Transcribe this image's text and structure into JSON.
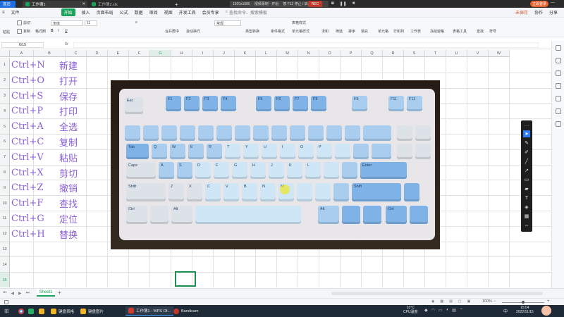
{
  "titlebar": {
    "home_tab": "首页",
    "doc_tab": "工作簿1",
    "doc_tab2": "工作簿2.xls",
    "add_tab": "+",
    "recorder": {
      "resolution": "1920x1080",
      "status": "视频录制 - 开始",
      "shortcut": "按 F12 停止 / 启动",
      "rec": "REC"
    },
    "user": "立即登录"
  },
  "menubar": {
    "file": "文件",
    "start": "开始",
    "items": [
      "插入",
      "页面布局",
      "公式",
      "数据",
      "审阅",
      "视图",
      "开发工具",
      "会员专享"
    ],
    "search": "查找命令、搜索模板",
    "right": [
      "未保存",
      "协作",
      "分享"
    ]
  },
  "ribbon": {
    "paste": "粘贴",
    "cut": "剪切",
    "copy": "复制",
    "format_painter": "格式刷",
    "font": "宋体",
    "font_size": "11",
    "merge": "合并居中",
    "wrap": "自动换行",
    "number_format": "常规",
    "type_convert": "类型转换",
    "cond_format": "条件格式",
    "table_style": "表格样式",
    "cell_style": "单元格样式",
    "sum": "求和",
    "filter": "筛选",
    "sort": "排序",
    "fill": "填充",
    "cell": "单元格",
    "row_col": "行和列",
    "worksheet": "工作表",
    "freeze": "冻结窗格",
    "table_tools": "表格工具",
    "find": "查找",
    "symbol": "符号"
  },
  "formula_bar": {
    "name_box": "G15",
    "fx": "fx",
    "value": ""
  },
  "columns": [
    "A",
    "B",
    "C",
    "D",
    "E",
    "F",
    "G",
    "H",
    "I",
    "J",
    "K",
    "L",
    "M",
    "N",
    "O",
    "P",
    "Q",
    "R",
    "S",
    "T",
    "U",
    "V",
    "W"
  ],
  "rows": [
    "1",
    "2",
    "3",
    "4",
    "5",
    "6",
    "7",
    "8",
    "9",
    "10",
    "11",
    "12",
    "13",
    "14",
    "15"
  ],
  "cells": [
    {
      "a": "Ctrl+N",
      "b": "新建"
    },
    {
      "a": "Ctrl+O",
      "b": "打开"
    },
    {
      "a": "Ctrl+S",
      "b": "保存"
    },
    {
      "a": "Ctrl+P",
      "b": "打印"
    },
    {
      "a": "Ctrl+A",
      "b": "全选"
    },
    {
      "a": "Ctrl+C",
      "b": "复制"
    },
    {
      "a": "Ctrl+V",
      "b": "粘贴"
    },
    {
      "a": "Ctrl+X",
      "b": "剪切"
    },
    {
      "a": "Ctrl+Z",
      "b": "撤销"
    },
    {
      "a": "Ctrl+F",
      "b": "查找"
    },
    {
      "a": "Ctrl+G",
      "b": "定位"
    },
    {
      "a": "Ctrl+H",
      "b": "替换"
    }
  ],
  "keyboard_keys": {
    "esc": "Esc",
    "f1": "F1",
    "f2": "F2",
    "f3": "F3",
    "f4": "F4",
    "f5": "F5",
    "f6": "F6",
    "f7": "F7",
    "f8": "F8",
    "f9": "F9",
    "f11": "F11",
    "f12": "F12",
    "tab": "Tab",
    "q": "Q",
    "w": "W",
    "e": "E",
    "r": "R",
    "t": "T",
    "y": "Y",
    "u": "U",
    "i": "I",
    "o": "O",
    "p": "P",
    "caps": "Caps",
    "a": "A",
    "s": "S",
    "d": "D",
    "f": "F",
    "g": "G",
    "h": "H",
    "j": "J",
    "k": "K",
    "l": "L",
    "enter": "Enter",
    "shift_l": "Shift",
    "z": "Z",
    "x": "X",
    "c": "C",
    "v": "V",
    "b": "B",
    "n": "N",
    "m": "M",
    "shift_r": "Shift",
    "ctrl_l": "Ctrl",
    "alt_l": "Alt",
    "alt_r": "Alt",
    "ctrl_r": "Ctrl"
  },
  "sheetbar": {
    "sheet": "Sheet1",
    "add": "+"
  },
  "statusbar": {
    "zoom": "100%"
  },
  "taskbar": {
    "apps": [
      "键盘表格",
      "键盘图片",
      "工作簿1 - WPS Of...",
      "Bandicam"
    ],
    "weather": "31°C",
    "weather_sub": "CPU温度",
    "time": "15:04",
    "date": "2022/11/15",
    "ime": "中"
  },
  "colors": {
    "accent": "#1aa15c",
    "text_purple": "#8a5fd6",
    "selection": "#1e8f4e"
  }
}
